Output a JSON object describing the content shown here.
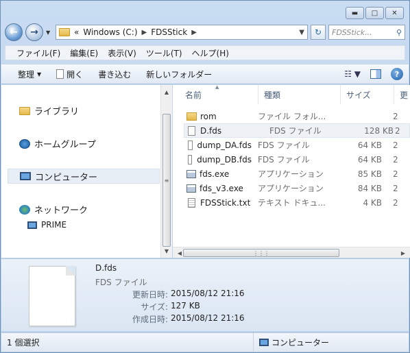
{
  "window": {
    "minimize_icon": "minimize-icon",
    "maximize_icon": "maximize-icon",
    "close_icon": "close-icon"
  },
  "address": {
    "chevrons": "«",
    "segments": [
      "Windows (C:)",
      "FDSStick"
    ],
    "search_placeholder": "FDSStick..."
  },
  "menubar": [
    "ファイル(F)",
    "編集(E)",
    "表示(V)",
    "ツール(T)",
    "ヘルプ(H)"
  ],
  "commands": {
    "organize": "整理",
    "open": "開く",
    "write": "書き込む",
    "new_folder": "新しいフォルダー"
  },
  "navpane": {
    "libraries": "ライブラリ",
    "homegroup": "ホームグループ",
    "computer": "コンピューター",
    "network": "ネットワーク",
    "prime": "PRIME"
  },
  "columns": {
    "name": "名前",
    "type": "種類",
    "size": "サイズ",
    "updated": "更"
  },
  "files": [
    {
      "name": "rom",
      "type": "ファイル フォル...",
      "size": "",
      "upd": "2",
      "icon": "folder"
    },
    {
      "name": "D.fds",
      "type": "FDS ファイル",
      "size": "128 KB",
      "upd": "2",
      "icon": "file"
    },
    {
      "name": "dump_DA.fds",
      "type": "FDS ファイル",
      "size": "64 KB",
      "upd": "2",
      "icon": "file"
    },
    {
      "name": "dump_DB.fds",
      "type": "FDS ファイル",
      "size": "64 KB",
      "upd": "2",
      "icon": "file"
    },
    {
      "name": "fds.exe",
      "type": "アプリケーション",
      "size": "85 KB",
      "upd": "2",
      "icon": "exe"
    },
    {
      "name": "fds_v3.exe",
      "type": "アプリケーション",
      "size": "84 KB",
      "upd": "2",
      "icon": "exe"
    },
    {
      "name": "FDSStick.txt",
      "type": "テキスト ドキュ...",
      "size": "4 KB",
      "upd": "2",
      "icon": "txt"
    }
  ],
  "details": {
    "name": "D.fds",
    "type": "FDS ファイル",
    "modified_label": "更新日時:",
    "modified_value": "2015/08/12 21:16",
    "size_label": "サイズ:",
    "size_value": "127 KB",
    "created_label": "作成日時:",
    "created_value": "2015/08/12 21:16"
  },
  "status": {
    "selection": "1 個選択",
    "location": "コンピューター"
  }
}
